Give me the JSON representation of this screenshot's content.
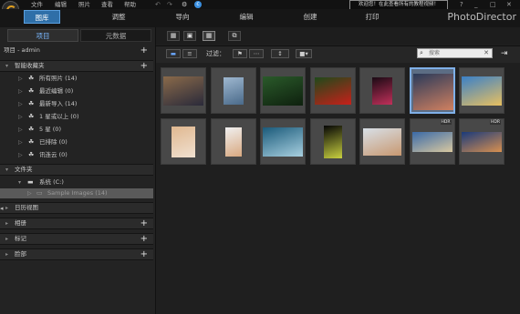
{
  "menubar": {
    "items": [
      "文件",
      "编辑",
      "照片",
      "查看",
      "帮助"
    ],
    "notice": "欢迎您！在此查看所有的教程视频！",
    "window_controls": [
      "?",
      "_",
      "□",
      "✕"
    ]
  },
  "modules": {
    "tabs": [
      "图库",
      "调整",
      "导向",
      "编辑",
      "创建",
      "打印"
    ],
    "active": "图库",
    "brand": "PhotoDirector"
  },
  "left_panel": {
    "tabs": [
      "项目",
      "元数据"
    ],
    "active_tab": "项目",
    "project_label": "项目 - admin",
    "smart_collections": {
      "title": "智能收藏夹",
      "items": [
        "所有照片 (14)",
        "最近编辑 (0)",
        "最新导入 (14)",
        "1 星或以上 (0)",
        "5 星 (0)",
        "已排除 (0)",
        "讯连云 (0)"
      ]
    },
    "folders": {
      "title": "文件夹",
      "system": "系统 (C:)",
      "selected": "Sample Images (14)"
    },
    "calendar": "日历视图",
    "albums": "相册",
    "tags": "标记",
    "faces": "脸部"
  },
  "toolbar": {
    "filter_label": "过滤：",
    "search_placeholder": "搜索"
  },
  "thumbnails": [
    {
      "name": "photo-bubble-party",
      "colors": [
        "#8a6a4a",
        "#2a2a3a"
      ]
    },
    {
      "name": "photo-city-tower",
      "colors": [
        "#9fb8d0",
        "#4a6a8a"
      ]
    },
    {
      "name": "photo-forest",
      "colors": [
        "#2a5a2a",
        "#0e200e"
      ]
    },
    {
      "name": "photo-red-flower",
      "colors": [
        "#1e4a1a",
        "#c8201a"
      ]
    },
    {
      "name": "photo-lantern",
      "colors": [
        "#1a0a14",
        "#c0305a"
      ]
    },
    {
      "name": "photo-fireworks",
      "colors": [
        "#2a3a5a",
        "#d08060"
      ],
      "selected": true
    },
    {
      "name": "photo-beach-jump",
      "colors": [
        "#3a80c8",
        "#e8c060"
      ]
    },
    {
      "name": "photo-woman-portrait",
      "colors": [
        "#e0b890",
        "#f0e0d0"
      ]
    },
    {
      "name": "photo-child-portrait",
      "colors": [
        "#f0f0f0",
        "#d8a880"
      ]
    },
    {
      "name": "photo-wave",
      "colors": [
        "#1a5a7a",
        "#a8d0e0"
      ]
    },
    {
      "name": "photo-dark-vase",
      "colors": [
        "#050505",
        "#c8d040"
      ]
    },
    {
      "name": "photo-blonde-woman",
      "colors": [
        "#d8e0e8",
        "#c89870"
      ]
    },
    {
      "name": "photo-panorama-hills",
      "colors": [
        "#3a6aa8",
        "#d8c8a0"
      ],
      "hdr": true
    },
    {
      "name": "photo-panorama-sunset",
      "colors": [
        "#1a3a7a",
        "#d89050"
      ],
      "hdr": true
    }
  ],
  "hdr_label": "HDR",
  "colors": {
    "accent": "#2f6fa8",
    "selection": "#7fb0e8",
    "link_blue": "#7ab8ff"
  }
}
